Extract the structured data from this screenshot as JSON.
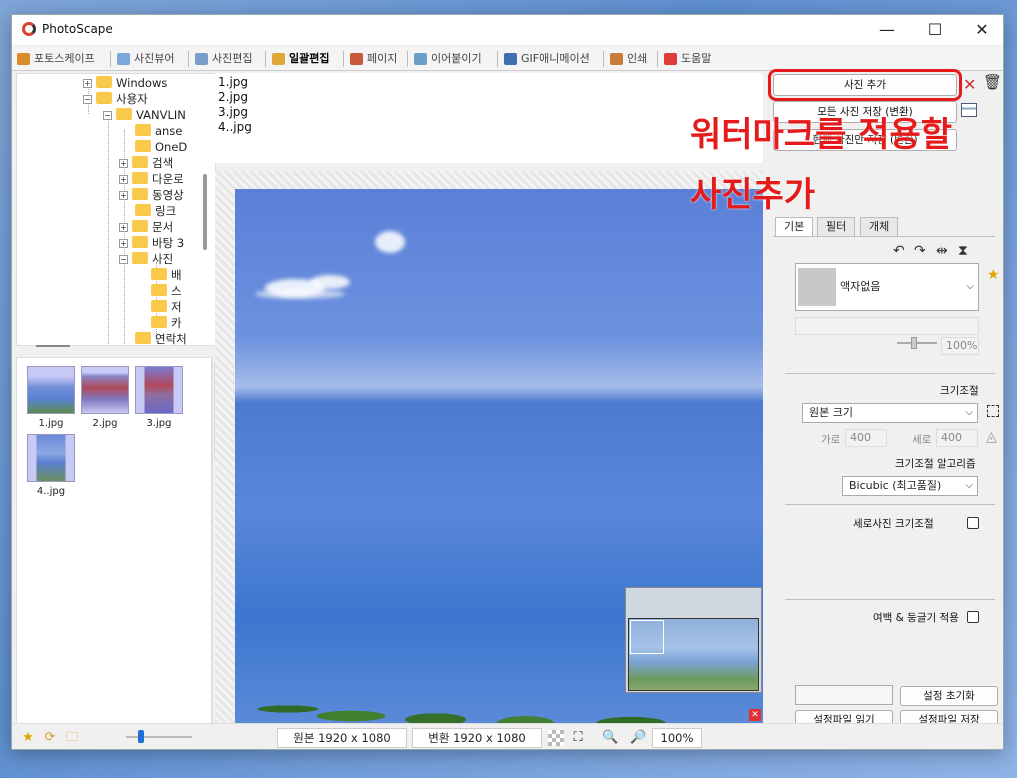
{
  "window": {
    "title": "PhotoScape",
    "minimize": "—",
    "maximize": "☐",
    "close": "✕"
  },
  "tabs": [
    {
      "label": "포토스케이프",
      "color": "#d98a2b"
    },
    {
      "label": "사진뷰어",
      "color": "#7da7d8"
    },
    {
      "label": "사진편집",
      "color": "#7a9dcc"
    },
    {
      "label": "일괄편집",
      "color": "#e0a638"
    },
    {
      "label": "페이지",
      "color": "#c85a3c"
    },
    {
      "label": "이어붙이기",
      "color": "#6aa0c8"
    },
    {
      "label": "GIF애니메이션",
      "color": "#3f6fb0"
    },
    {
      "label": "인쇄",
      "color": "#c87b3a"
    },
    {
      "label": "도움말",
      "color": "#e03b3b"
    }
  ],
  "tree": [
    {
      "label": "Windows",
      "exp": "+"
    },
    {
      "label": "사용자",
      "exp": "−"
    },
    {
      "label": "VANVLIN",
      "exp": "−"
    },
    {
      "label": "anse",
      "exp": ""
    },
    {
      "label": "OneD",
      "exp": ""
    },
    {
      "label": "검색",
      "exp": "+"
    },
    {
      "label": "다운로",
      "exp": "+"
    },
    {
      "label": "동영상",
      "exp": "+"
    },
    {
      "label": "링크",
      "exp": ""
    },
    {
      "label": "문서",
      "exp": "+"
    },
    {
      "label": "바탕 3",
      "exp": "+"
    },
    {
      "label": "사진",
      "exp": "−"
    },
    {
      "label": "배",
      "exp": ""
    },
    {
      "label": "스",
      "exp": ""
    },
    {
      "label": "저",
      "exp": ""
    },
    {
      "label": "카",
      "exp": ""
    },
    {
      "label": "연락처",
      "exp": ""
    }
  ],
  "thumbnails": [
    {
      "caption": "1.jpg"
    },
    {
      "caption": "2.jpg"
    },
    {
      "caption": "3.jpg"
    },
    {
      "caption": "4..jpg"
    }
  ],
  "files": [
    "1.jpg",
    "2.jpg",
    "3.jpg",
    "4..jpg"
  ],
  "right": {
    "add_photo": "사진 추가",
    "save_all": "모든 사진 저장 (변환)",
    "save_current": "현재 사진만 저장 (변환)",
    "tabs": [
      "기본",
      "필터",
      "개체"
    ],
    "frame_select": "액자없음",
    "frame_percent": "100%",
    "resize_title": "크기조절",
    "resize_select": "원본 크기",
    "width_label": "가로",
    "width_value": "400",
    "height_label": "세로",
    "height_value": "400",
    "algo_title": "크기조절 알고리즘",
    "algo_select": "Bicubic (최고품질)",
    "portrait_resize": "세로사진 크기조절",
    "margin_round": "여백 & 둥글기 적용",
    "reset_settings": "설정 초기화",
    "load_settings": "설정파일 읽기",
    "save_settings": "설정파일 저장"
  },
  "annotation": {
    "line1": "워터마크를 적용할",
    "line2": "사진추가",
    "color": "#e51b1b"
  },
  "status": {
    "original": "원본 1920 x 1080",
    "converted": "변환 1920 x 1080",
    "zoom": "100%"
  }
}
